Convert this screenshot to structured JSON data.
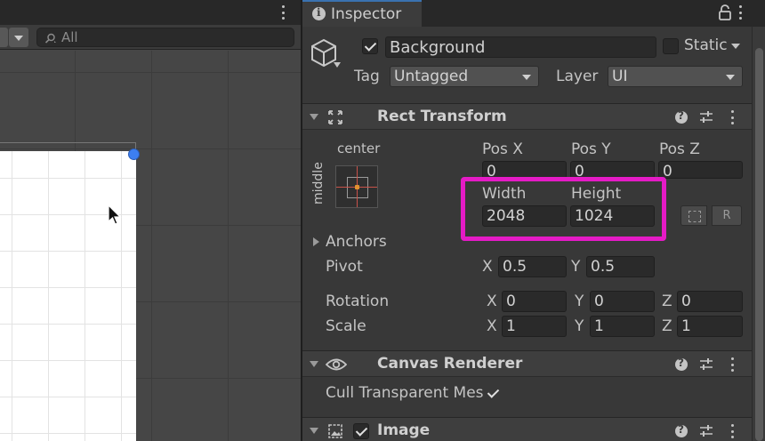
{
  "scene": {
    "search_placeholder": "All"
  },
  "inspector": {
    "tab_label": "Inspector",
    "object": {
      "name": "Background",
      "active": true,
      "static_label": "Static",
      "static": false,
      "tag_label": "Tag",
      "tag_value": "Untagged",
      "layer_label": "Layer",
      "layer_value": "UI"
    },
    "rect_transform": {
      "title": "Rect Transform",
      "anchor_preset_horizontal": "center",
      "anchor_preset_vertical": "middle",
      "pos_x_label": "Pos X",
      "pos_y_label": "Pos Y",
      "pos_z_label": "Pos Z",
      "pos_x": "0",
      "pos_y": "0",
      "pos_z": "0",
      "width_label": "Width",
      "height_label": "Height",
      "width": "2048",
      "height": "1024",
      "raw_button_label": "R",
      "anchors_label": "Anchors",
      "pivot_label": "Pivot",
      "pivot_x_label": "X",
      "pivot_x": "0.5",
      "pivot_y_label": "Y",
      "pivot_y": "0.5",
      "rotation_label": "Rotation",
      "rotation": {
        "x_label": "X",
        "x": "0",
        "y_label": "Y",
        "y": "0",
        "z_label": "Z",
        "z": "0"
      },
      "scale_label": "Scale",
      "scale": {
        "x_label": "X",
        "x": "1",
        "y_label": "Y",
        "y": "1",
        "z_label": "Z",
        "z": "1"
      }
    },
    "canvas_renderer": {
      "title": "Canvas Renderer",
      "cull_label": "Cull Transparent Mes",
      "cull_checked": true
    },
    "image": {
      "title": "Image",
      "enabled": true
    }
  },
  "colors": {
    "highlight": "#e51bc6",
    "handle": "#3d7ff1",
    "panel_bg": "#383838",
    "field_bg": "#2a2a2a"
  }
}
